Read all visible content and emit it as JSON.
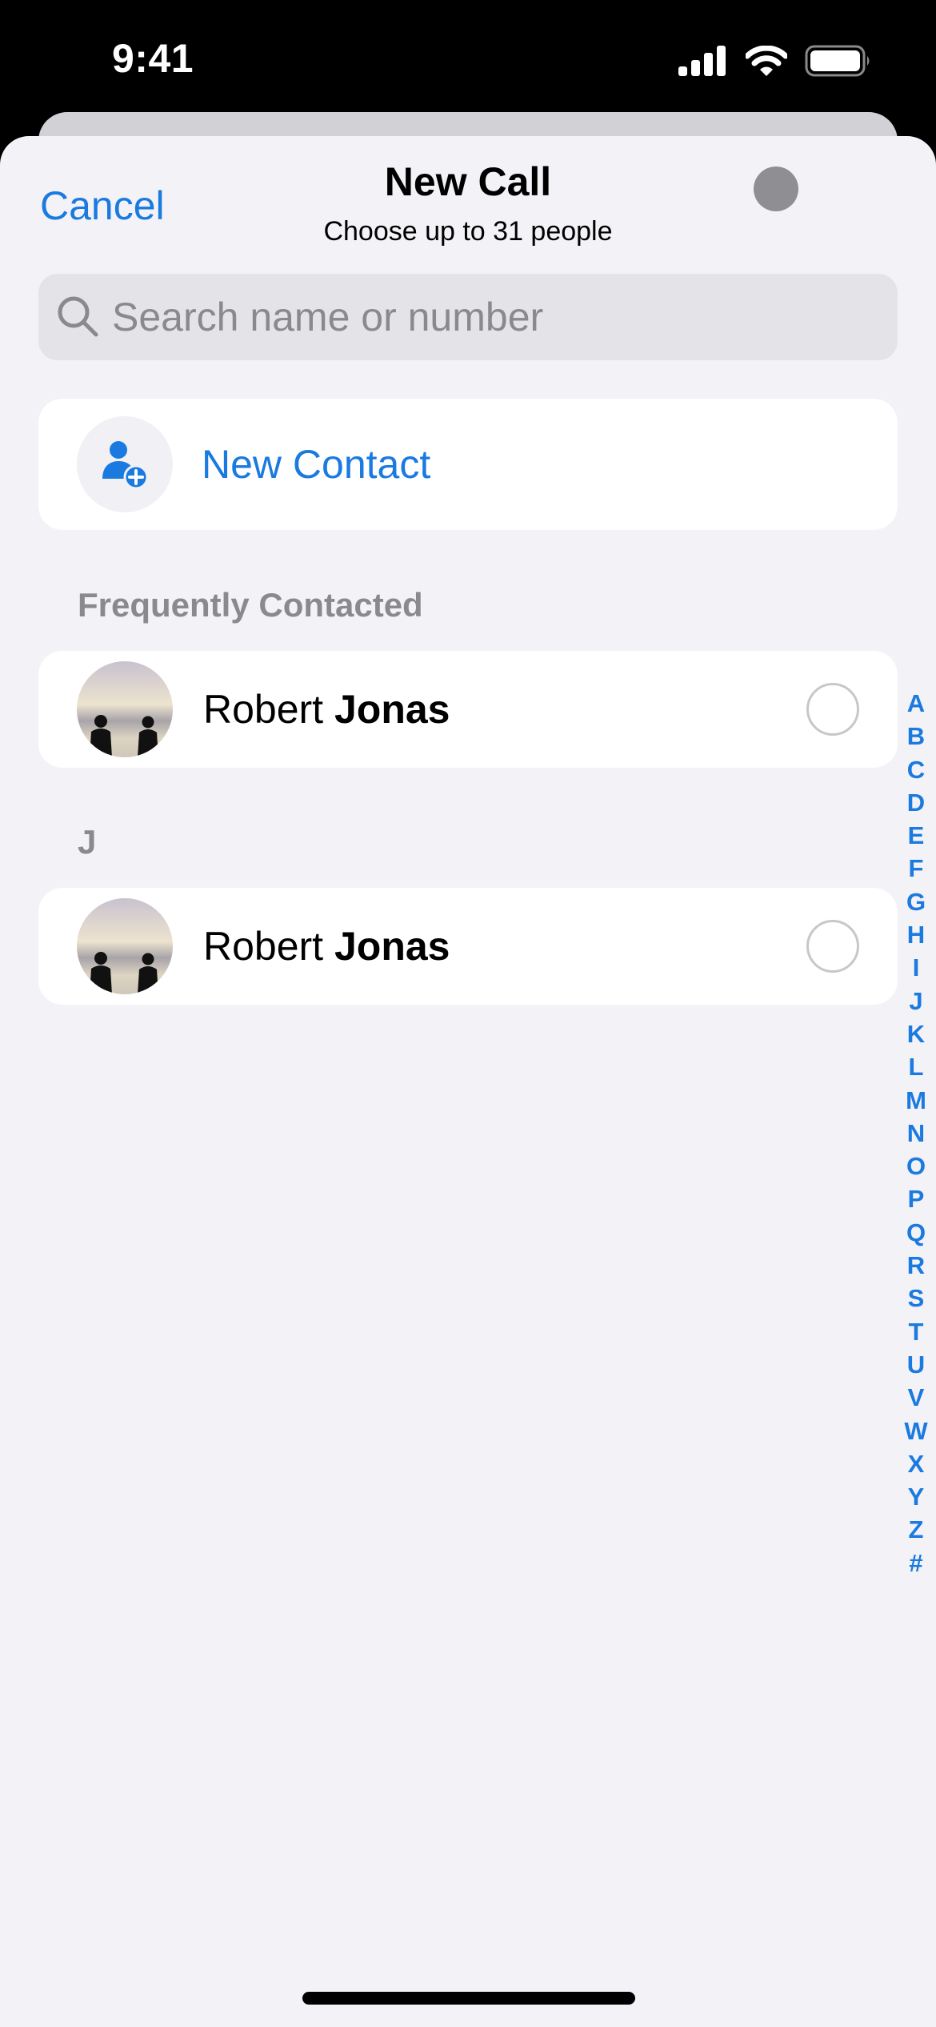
{
  "status_bar": {
    "time": "9:41",
    "icons": [
      "signal-icon",
      "wifi-icon",
      "battery-icon"
    ]
  },
  "nav": {
    "cancel_label": "Cancel",
    "title": "New Call",
    "subtitle": "Choose up to 31 people"
  },
  "search": {
    "icon": "search-icon",
    "placeholder": "Search name or number",
    "value": ""
  },
  "new_contact": {
    "icon": "person-add-icon",
    "label": "New Contact"
  },
  "sections": [
    {
      "header": "Frequently Contacted",
      "contacts": [
        {
          "first_name": "Robert",
          "last_name": "Jonas",
          "selected": false
        }
      ]
    },
    {
      "header": "J",
      "contacts": [
        {
          "first_name": "Robert",
          "last_name": "Jonas",
          "selected": false
        }
      ]
    }
  ],
  "index_letters": [
    "A",
    "B",
    "C",
    "D",
    "E",
    "F",
    "G",
    "H",
    "I",
    "J",
    "K",
    "L",
    "M",
    "N",
    "O",
    "P",
    "Q",
    "R",
    "S",
    "T",
    "U",
    "V",
    "W",
    "X",
    "Y",
    "Z",
    "#"
  ],
  "colors": {
    "accent": "#1a7ae0",
    "background": "#f2f2f7",
    "secondary_text": "#8a8a8e"
  }
}
